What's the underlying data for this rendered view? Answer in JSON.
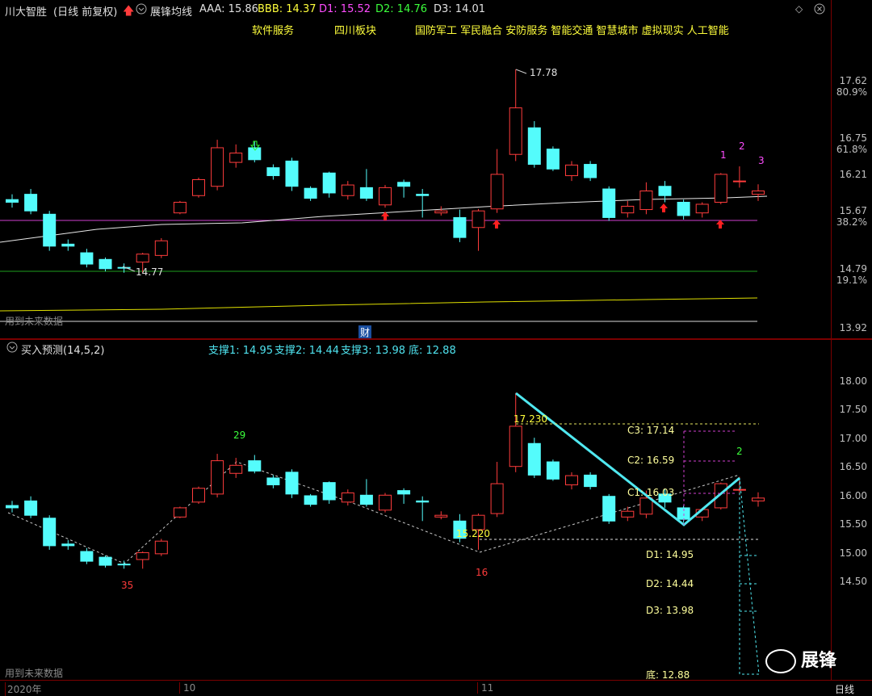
{
  "top": {
    "stock_title": "川大智胜",
    "stock_mode": "(日线 前复权)",
    "indicator_name": "展锋均线",
    "aaa": "AAA: 15.86",
    "bbb": "BBB: 14.37",
    "d1": "D1: 15.52",
    "d2": "D2: 14.76",
    "d3": "D3: 14.01",
    "tags": [
      "软件服务",
      "四川板块",
      "国防军工 军民融合 安防服务 智能交通 智慧城市 虚拟现实 人工智能"
    ],
    "peak_label": "17.78",
    "low_label": "14.77",
    "future_data": "用到未来数据",
    "finance_marker": "财",
    "signal_numbers": [
      "1",
      "2",
      "3"
    ],
    "price_axis": [
      {
        "price": "17.62",
        "pct": "80.9%"
      },
      {
        "price": "16.75",
        "pct": "61.8%"
      },
      {
        "price": "16.21",
        "pct": ""
      },
      {
        "price": "15.67",
        "pct": "38.2%"
      },
      {
        "price": "14.79",
        "pct": "19.1%"
      },
      {
        "price": "13.92",
        "pct": ""
      }
    ]
  },
  "bottom": {
    "indicator_name": "买入预测(14,5,2)",
    "support1": "支撑1: 14.95",
    "support2": "支撑2: 14.44",
    "support3": "支撑3: 13.98",
    "bottom": "底: 12.88",
    "wave_labels": {
      "w29": "29",
      "w35": "35",
      "w16": "16",
      "w2": "2"
    },
    "price_labels": {
      "p17230": "17.230",
      "p15220": "15.220"
    },
    "c3": "C3: 17.14",
    "c2": "C2: 16.59",
    "c1": "C1: 16.03",
    "dd1": "D1: 14.95",
    "dd2": "D2: 14.44",
    "dd3": "D3: 13.98",
    "ddi": "底: 12.88",
    "future_data": "用到未来数据",
    "price_axis": [
      "18.00",
      "17.50",
      "17.00",
      "16.50",
      "16.00",
      "15.50",
      "15.00",
      "14.50"
    ]
  },
  "timeline": {
    "year": "2020年",
    "m10": "10",
    "m11": "11",
    "period": "日线"
  },
  "watermark": "展锋",
  "candles": [
    [
      15.82,
      15.78,
      15.9,
      15.7
    ],
    [
      15.9,
      15.65,
      15.98,
      15.6
    ],
    [
      15.6,
      15.12,
      15.65,
      15.05
    ],
    [
      15.15,
      15.12,
      15.22,
      15.05
    ],
    [
      15.02,
      14.85,
      15.08,
      14.8
    ],
    [
      14.92,
      14.78,
      14.95,
      14.74
    ],
    [
      14.8,
      14.79,
      14.86,
      14.72
    ],
    [
      14.88,
      15.0,
      15.02,
      14.72
    ],
    [
      14.98,
      15.2,
      15.24,
      14.94
    ],
    [
      15.62,
      15.78,
      15.8,
      15.6
    ],
    [
      15.88,
      16.12,
      16.15,
      15.85
    ],
    [
      16.02,
      16.6,
      16.72,
      15.96
    ],
    [
      16.38,
      16.52,
      16.65,
      16.3
    ],
    [
      16.6,
      16.42,
      16.7,
      16.38
    ],
    [
      16.3,
      16.18,
      16.35,
      16.12
    ],
    [
      16.4,
      16.02,
      16.45,
      15.95
    ],
    [
      15.99,
      15.84,
      16.02,
      15.8
    ],
    [
      16.22,
      15.92,
      16.24,
      15.85
    ],
    [
      15.88,
      16.04,
      16.1,
      15.82
    ],
    [
      16.0,
      15.84,
      16.28,
      15.8
    ],
    [
      15.74,
      16.0,
      16.04,
      15.7
    ],
    [
      16.08,
      16.02,
      16.12,
      15.85
    ],
    [
      15.9,
      15.88,
      15.98,
      15.55
    ],
    [
      15.62,
      15.65,
      15.72,
      15.58
    ],
    [
      15.55,
      15.25,
      15.67,
      15.18
    ],
    [
      15.4,
      15.65,
      15.68,
      15.05
    ],
    [
      15.68,
      16.2,
      16.58,
      15.62
    ],
    [
      16.5,
      17.2,
      17.78,
      16.4
    ],
    [
      16.9,
      16.35,
      17.0,
      16.3
    ],
    [
      16.58,
      16.28,
      16.62,
      16.25
    ],
    [
      16.18,
      16.34,
      16.4,
      16.1
    ],
    [
      16.35,
      16.15,
      16.4,
      16.1
    ],
    [
      15.98,
      15.55,
      16.02,
      15.5
    ],
    [
      15.62,
      15.72,
      15.8,
      15.55
    ],
    [
      15.67,
      15.95,
      16.08,
      15.6
    ],
    [
      16.02,
      15.88,
      16.1,
      15.78
    ],
    [
      15.78,
      15.58,
      15.82,
      15.52
    ],
    [
      15.62,
      15.75,
      15.78,
      15.55
    ],
    [
      15.78,
      16.2,
      16.22,
      15.75
    ],
    [
      16.1,
      16.1,
      16.32,
      16.0
    ],
    [
      15.9,
      15.95,
      16.05,
      15.8
    ]
  ]
}
